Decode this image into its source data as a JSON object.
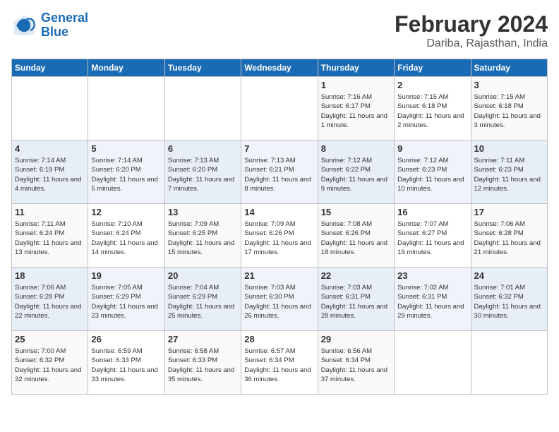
{
  "logo": {
    "line1": "General",
    "line2": "Blue"
  },
  "title": "February 2024",
  "subtitle": "Dariba, Rajasthan, India",
  "weekdays": [
    "Sunday",
    "Monday",
    "Tuesday",
    "Wednesday",
    "Thursday",
    "Friday",
    "Saturday"
  ],
  "weeks": [
    [
      {
        "day": "",
        "info": ""
      },
      {
        "day": "",
        "info": ""
      },
      {
        "day": "",
        "info": ""
      },
      {
        "day": "",
        "info": ""
      },
      {
        "day": "1",
        "info": "Sunrise: 7:16 AM\nSunset: 6:17 PM\nDaylight: 11 hours\nand 1 minute."
      },
      {
        "day": "2",
        "info": "Sunrise: 7:15 AM\nSunset: 6:18 PM\nDaylight: 11 hours\nand 2 minutes."
      },
      {
        "day": "3",
        "info": "Sunrise: 7:15 AM\nSunset: 6:18 PM\nDaylight: 11 hours\nand 3 minutes."
      }
    ],
    [
      {
        "day": "4",
        "info": "Sunrise: 7:14 AM\nSunset: 6:19 PM\nDaylight: 11 hours\nand 4 minutes."
      },
      {
        "day": "5",
        "info": "Sunrise: 7:14 AM\nSunset: 6:20 PM\nDaylight: 11 hours\nand 5 minutes."
      },
      {
        "day": "6",
        "info": "Sunrise: 7:13 AM\nSunset: 6:20 PM\nDaylight: 11 hours\nand 7 minutes."
      },
      {
        "day": "7",
        "info": "Sunrise: 7:13 AM\nSunset: 6:21 PM\nDaylight: 11 hours\nand 8 minutes."
      },
      {
        "day": "8",
        "info": "Sunrise: 7:12 AM\nSunset: 6:22 PM\nDaylight: 11 hours\nand 9 minutes."
      },
      {
        "day": "9",
        "info": "Sunrise: 7:12 AM\nSunset: 6:23 PM\nDaylight: 11 hours\nand 10 minutes."
      },
      {
        "day": "10",
        "info": "Sunrise: 7:11 AM\nSunset: 6:23 PM\nDaylight: 11 hours\nand 12 minutes."
      }
    ],
    [
      {
        "day": "11",
        "info": "Sunrise: 7:11 AM\nSunset: 6:24 PM\nDaylight: 11 hours\nand 13 minutes."
      },
      {
        "day": "12",
        "info": "Sunrise: 7:10 AM\nSunset: 6:24 PM\nDaylight: 11 hours\nand 14 minutes."
      },
      {
        "day": "13",
        "info": "Sunrise: 7:09 AM\nSunset: 6:25 PM\nDaylight: 11 hours\nand 15 minutes."
      },
      {
        "day": "14",
        "info": "Sunrise: 7:09 AM\nSunset: 6:26 PM\nDaylight: 11 hours\nand 17 minutes."
      },
      {
        "day": "15",
        "info": "Sunrise: 7:08 AM\nSunset: 6:26 PM\nDaylight: 11 hours\nand 18 minutes."
      },
      {
        "day": "16",
        "info": "Sunrise: 7:07 AM\nSunset: 6:27 PM\nDaylight: 11 hours\nand 19 minutes."
      },
      {
        "day": "17",
        "info": "Sunrise: 7:06 AM\nSunset: 6:28 PM\nDaylight: 11 hours\nand 21 minutes."
      }
    ],
    [
      {
        "day": "18",
        "info": "Sunrise: 7:06 AM\nSunset: 6:28 PM\nDaylight: 11 hours\nand 22 minutes."
      },
      {
        "day": "19",
        "info": "Sunrise: 7:05 AM\nSunset: 6:29 PM\nDaylight: 11 hours\nand 23 minutes."
      },
      {
        "day": "20",
        "info": "Sunrise: 7:04 AM\nSunset: 6:29 PM\nDaylight: 11 hours\nand 25 minutes."
      },
      {
        "day": "21",
        "info": "Sunrise: 7:03 AM\nSunset: 6:30 PM\nDaylight: 11 hours\nand 26 minutes."
      },
      {
        "day": "22",
        "info": "Sunrise: 7:03 AM\nSunset: 6:31 PM\nDaylight: 11 hours\nand 28 minutes."
      },
      {
        "day": "23",
        "info": "Sunrise: 7:02 AM\nSunset: 6:31 PM\nDaylight: 11 hours\nand 29 minutes."
      },
      {
        "day": "24",
        "info": "Sunrise: 7:01 AM\nSunset: 6:32 PM\nDaylight: 11 hours\nand 30 minutes."
      }
    ],
    [
      {
        "day": "25",
        "info": "Sunrise: 7:00 AM\nSunset: 6:32 PM\nDaylight: 11 hours\nand 32 minutes."
      },
      {
        "day": "26",
        "info": "Sunrise: 6:59 AM\nSunset: 6:33 PM\nDaylight: 11 hours\nand 33 minutes."
      },
      {
        "day": "27",
        "info": "Sunrise: 6:58 AM\nSunset: 6:33 PM\nDaylight: 11 hours\nand 35 minutes."
      },
      {
        "day": "28",
        "info": "Sunrise: 6:57 AM\nSunset: 6:34 PM\nDaylight: 11 hours\nand 36 minutes."
      },
      {
        "day": "29",
        "info": "Sunrise: 6:56 AM\nSunset: 6:34 PM\nDaylight: 11 hours\nand 37 minutes."
      },
      {
        "day": "",
        "info": ""
      },
      {
        "day": "",
        "info": ""
      }
    ]
  ]
}
